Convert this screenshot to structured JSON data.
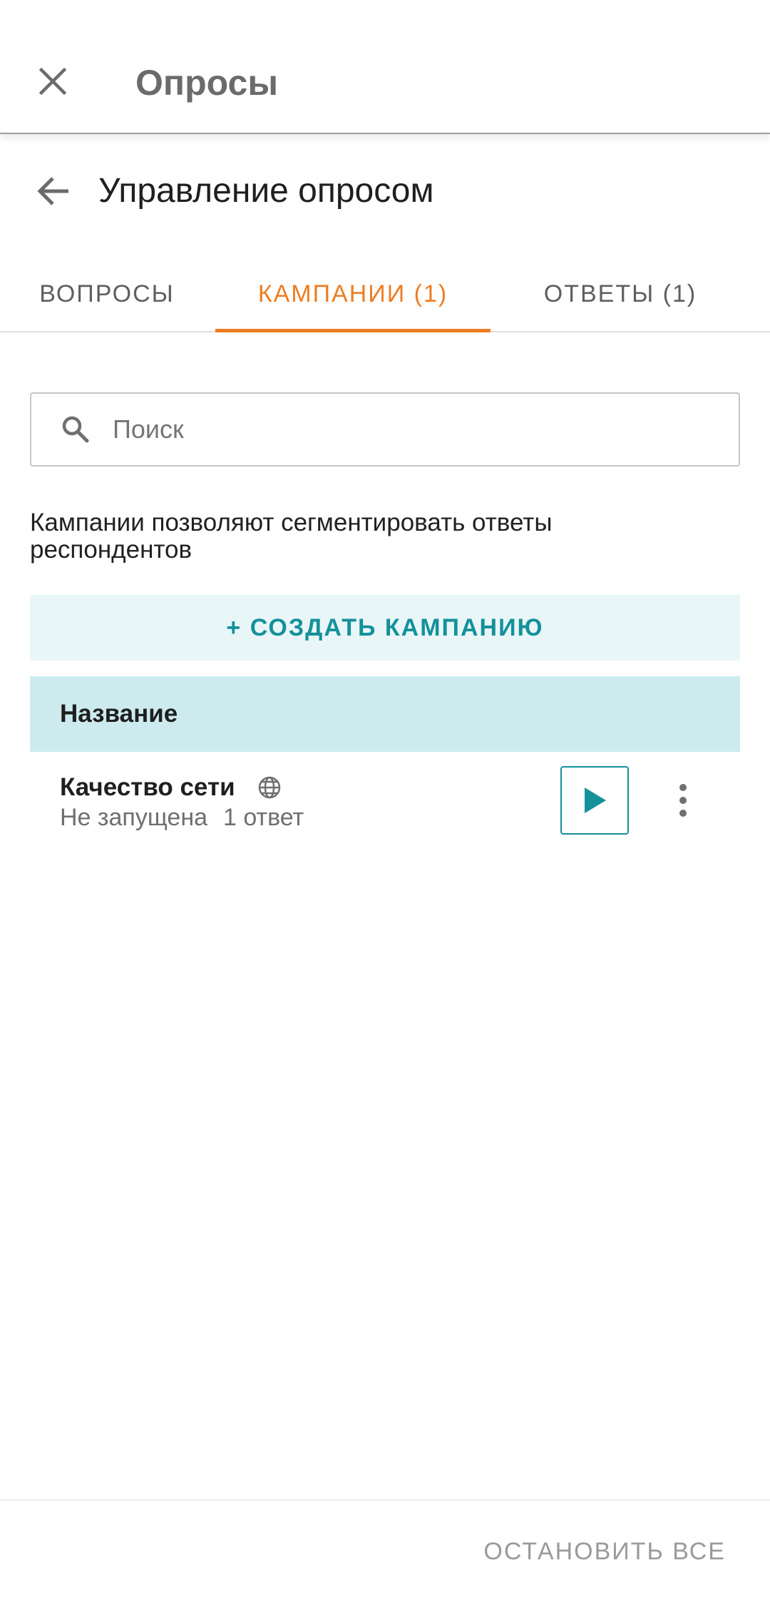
{
  "appbar": {
    "title": "Опросы",
    "close_icon": "close-icon"
  },
  "subheader": {
    "title": "Управление опросом",
    "back_icon": "arrow-back-icon"
  },
  "tabs": [
    {
      "label": "ВОПРОСЫ",
      "active": false
    },
    {
      "label": "КАМПАНИИ (1)",
      "active": true
    },
    {
      "label": "ОТВЕТЫ (1)",
      "active": false
    }
  ],
  "search": {
    "placeholder": "Поиск",
    "value": ""
  },
  "description": "Кампании позволяют сегментировать ответы респондентов",
  "create_button": {
    "label": "+ СОЗДАТЬ КАМПАНИЮ"
  },
  "table": {
    "header": "Название",
    "rows": [
      {
        "name": "Качество сети",
        "status": "Не запущена",
        "responses": "1 ответ"
      }
    ]
  },
  "bottom": {
    "stop_all_label": "ОСТАНОВИТЬ ВСЕ"
  },
  "colors": {
    "accent": "#ee7d22",
    "teal": "#14919b",
    "header_bg": "#cdebee",
    "create_bg": "#e9f6f8"
  }
}
